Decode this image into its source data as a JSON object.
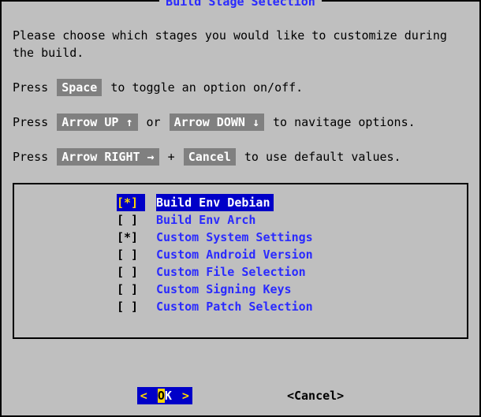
{
  "title": "Build Stage Selection",
  "intro": "Please choose which stages you would like to customize during the build.",
  "hints": {
    "space": {
      "pre": "Press ",
      "key": "Space",
      "post": " to toggle an option on/off."
    },
    "arrows": {
      "pre": "Press ",
      "up": "Arrow UP ↑",
      "mid": " or ",
      "down": "Arrow DOWN ↓",
      "post": " to navitage options."
    },
    "right": {
      "pre": "Press ",
      "key": "Arrow RIGHT →",
      "plus": " + ",
      "cancel": "Cancel",
      "post": " to use default values."
    }
  },
  "options": [
    {
      "checked": true,
      "selected": true,
      "label": "Build Env Debian"
    },
    {
      "checked": false,
      "selected": false,
      "label": "Build Env Arch"
    },
    {
      "checked": true,
      "selected": false,
      "label": "Custom System Settings"
    },
    {
      "checked": false,
      "selected": false,
      "label": "Custom Android Version"
    },
    {
      "checked": false,
      "selected": false,
      "label": "Custom File Selection"
    },
    {
      "checked": false,
      "selected": false,
      "label": "Custom Signing Keys"
    },
    {
      "checked": false,
      "selected": false,
      "label": "Custom Patch Selection"
    }
  ],
  "buttons": {
    "ok": {
      "lt": "<  ",
      "hot": "O",
      "rest": "K",
      "gt": "  >"
    },
    "cancel": "<Cancel>"
  }
}
